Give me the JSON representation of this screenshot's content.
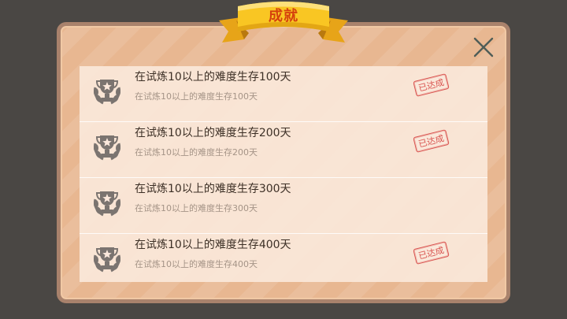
{
  "dialog": {
    "title": "成就",
    "close_icon": "close-icon"
  },
  "achievements": [
    {
      "title": "在试炼10以上的难度生存100天",
      "description": "在试炼10以上的难度生存100天",
      "status": "已达成",
      "icon": "trophy-icon"
    },
    {
      "title": "在试炼10以上的难度生存200天",
      "description": "在试炼10以上的难度生存200天",
      "status": "已达成",
      "icon": "trophy-icon"
    },
    {
      "title": "在试炼10以上的难度生存300天",
      "description": "在试炼10以上的难度生存300天",
      "status": "",
      "icon": "trophy-icon"
    },
    {
      "title": "在试炼10以上的难度生存400天",
      "description": "在试炼10以上的难度生存400天",
      "status": "已达成",
      "icon": "trophy-icon"
    }
  ],
  "colors": {
    "background": "#4a4744",
    "panel": "#e8b791",
    "panel_border": "#a9826c",
    "ribbon": "#f7c21b",
    "ribbon_text": "#d5410d",
    "stamp": "#d9534f"
  }
}
